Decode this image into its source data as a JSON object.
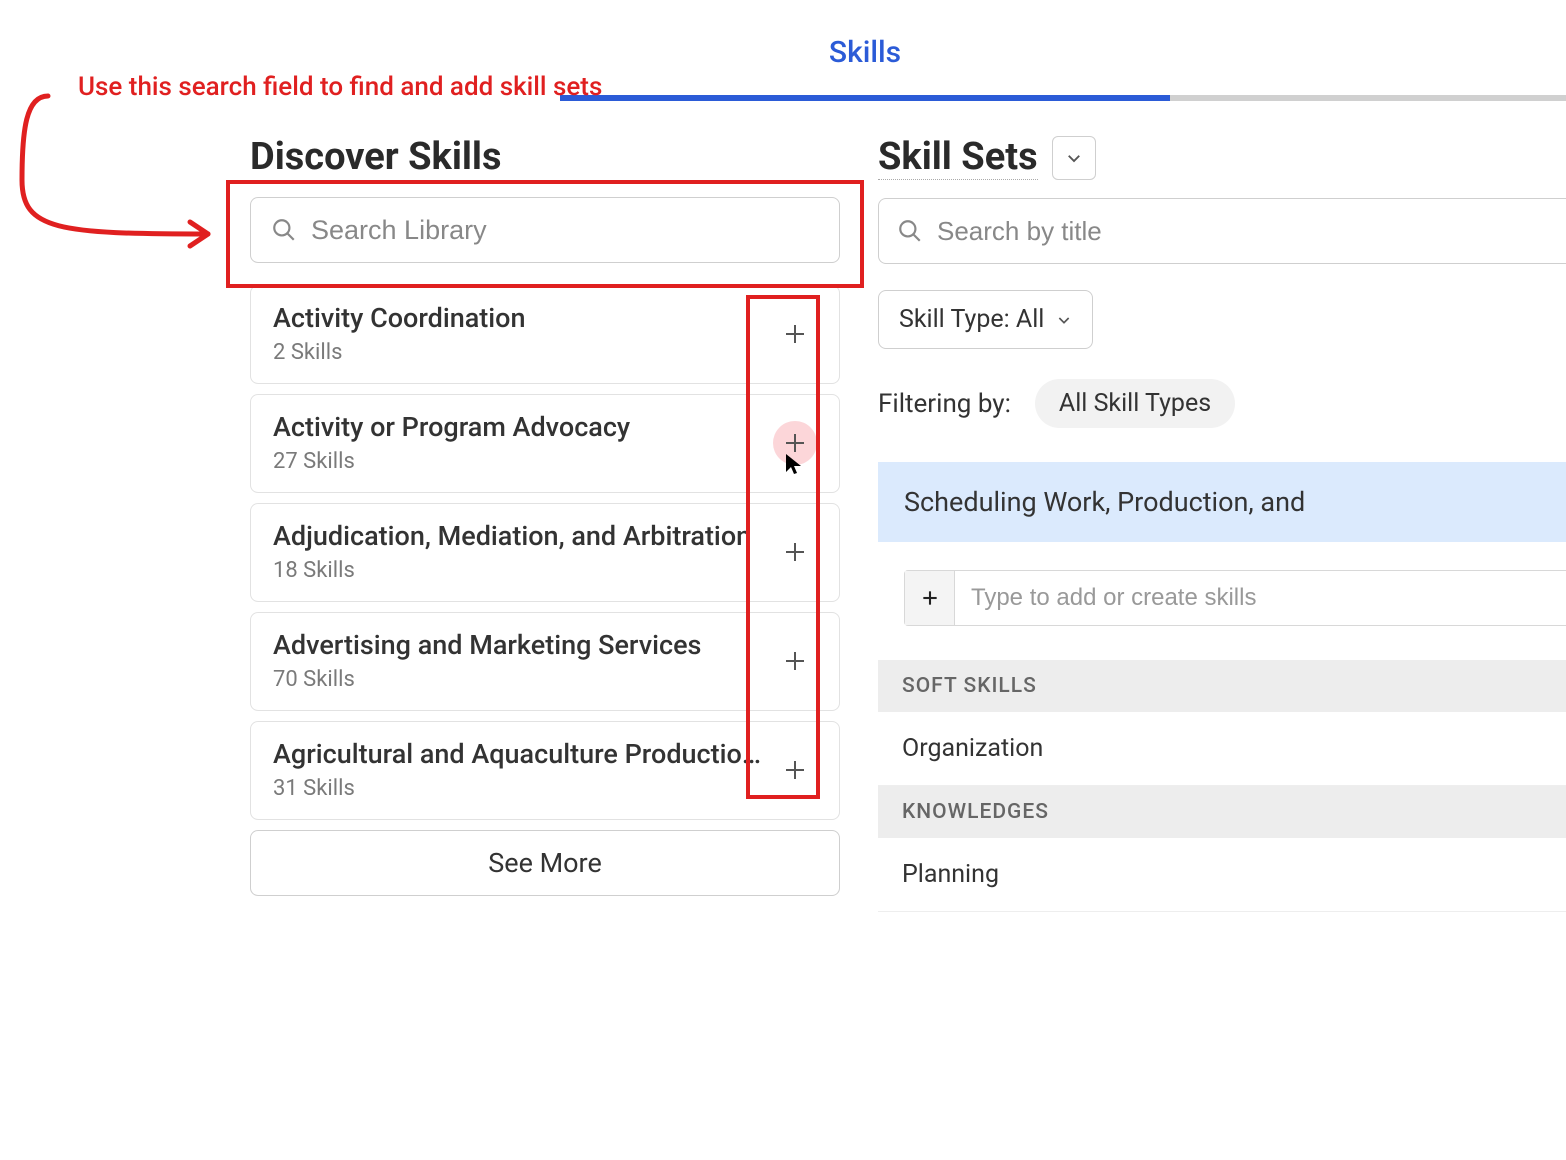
{
  "tab": {
    "label": "Skills"
  },
  "annotation": {
    "text": "Use this search field to find and add skill sets"
  },
  "discover": {
    "title": "Discover Skills",
    "search_placeholder": "Search Library",
    "items": [
      {
        "name": "Activity Coordination",
        "count": "2 Skills"
      },
      {
        "name": "Activity or Program Advocacy",
        "count": "27 Skills"
      },
      {
        "name": "Adjudication, Mediation, and Arbitration",
        "count": "18 Skills"
      },
      {
        "name": "Advertising and Marketing Services",
        "count": "70 Skills"
      },
      {
        "name": "Agricultural and Aquaculture Productio...",
        "count": "31 Skills"
      }
    ],
    "see_more": "See More"
  },
  "skillsets": {
    "title": "Skill Sets",
    "search_placeholder": "Search by title",
    "type_label": "Skill Type: All",
    "filtering_label": "Filtering by:",
    "filter_chip": "All Skill Types",
    "banner": "Scheduling Work, Production, and",
    "add_placeholder": "Type to add or create skills",
    "sections": {
      "soft_header": "SOFT SKILLS",
      "soft_item": "Organization",
      "knowledge_header": "KNOWLEDGES",
      "knowledge_item": "Planning"
    }
  }
}
